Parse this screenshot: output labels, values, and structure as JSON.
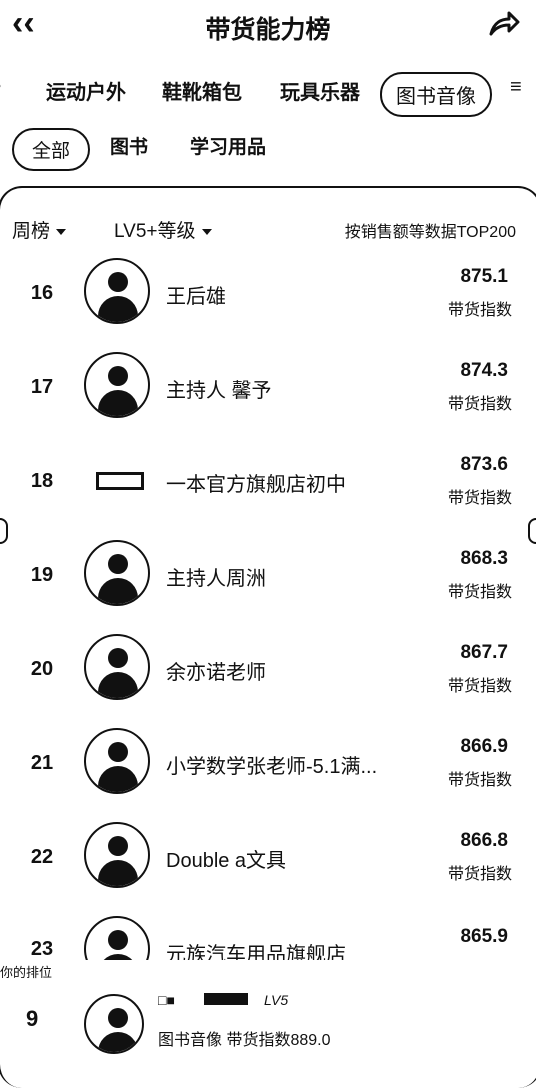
{
  "header": {
    "title": "带货能力榜",
    "back_icon": "chevron-left-icon",
    "share_icon": "share-arrow-icon"
  },
  "categories": [
    "运动户外",
    "鞋靴箱包",
    "玩具乐器",
    "图书音像"
  ],
  "active_category": "图书音像",
  "subcategories": [
    "全部",
    "图书",
    "学习用品"
  ],
  "active_subcategory": "全部",
  "filters": {
    "period": "周榜",
    "level": "LV5+等级",
    "note": "按销售额等数据TOP200"
  },
  "rows": [
    {
      "rank": "16",
      "name": "王后雄",
      "score": "875.1",
      "label": "带货指数"
    },
    {
      "rank": "17",
      "name": "主持人 馨予",
      "score": "874.3",
      "label": "带货指数"
    },
    {
      "rank": "18",
      "name": "一本官方旗舰店初中",
      "score": "873.6",
      "label": "带货指数"
    },
    {
      "rank": "19",
      "name": "主持人周洲",
      "score": "868.3",
      "label": "带货指数"
    },
    {
      "rank": "20",
      "name": "余亦诺老师",
      "score": "867.7",
      "label": "带货指数"
    },
    {
      "rank": "21",
      "name": "小学数学张老师-5.1满...",
      "score": "866.9",
      "label": "带货指数"
    },
    {
      "rank": "22",
      "name": "Double a文具",
      "score": "866.8",
      "label": "带货指数"
    },
    {
      "rank": "23",
      "name": "元族汽车用品旗舰店",
      "score": "865.9",
      "label": ""
    }
  ],
  "my_position": {
    "label": "你的排位",
    "rank": "9",
    "badge": "LV5",
    "category_line": "图书音像  带货指数889.0"
  }
}
